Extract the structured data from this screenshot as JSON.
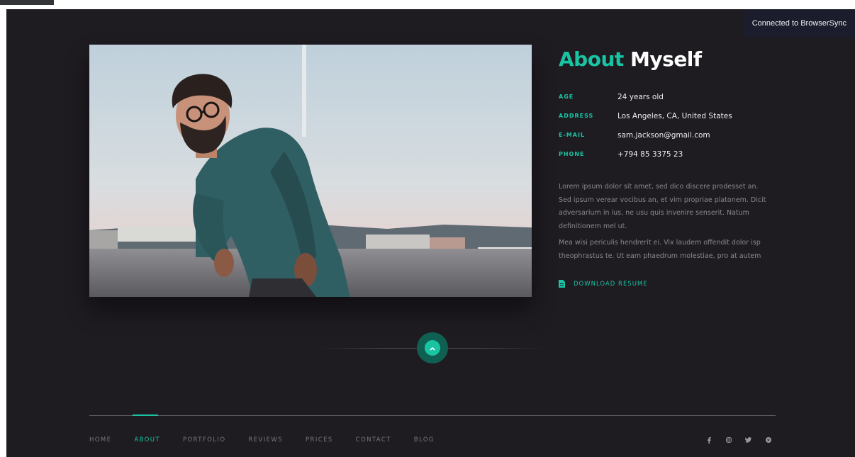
{
  "notification": {
    "text": "Connected to BrowserSync"
  },
  "about": {
    "title_accent": "About",
    "title_rest": "Myself",
    "info": [
      {
        "label": "AGE",
        "value": "24 years old"
      },
      {
        "label": "ADDRESS",
        "value": "Los Angeles, CA, United States"
      },
      {
        "label": "E-MAIL",
        "value": "sam.jackson@gmail.com"
      },
      {
        "label": "PHONE",
        "value": "+794 85 3375 23"
      }
    ],
    "bio": [
      "Lorem ipsum dolor sit amet, sed dico discere prodesset an. Sed ipsum verear vocibus an, et vim propriae platonem. Dicit adversarium in ius, ne usu quis invenire senserit. Natum definitionem mel ut.",
      "Mea wisi periculis hendrerit ei. Vix laudem offendit dolor isp theophrastus te. Ut eam phaedrum molestiae, pro at autem"
    ],
    "download_label": "DOWNLOAD RESUME",
    "download_icon": "document-icon"
  },
  "nav": {
    "items": [
      "HOME",
      "ABOUT",
      "PORTFOLIO",
      "REVIEWS",
      "PRICES",
      "CONTACT",
      "BLOG"
    ],
    "active": "ABOUT"
  },
  "social": [
    "facebook-icon",
    "instagram-icon",
    "twitter-icon",
    "pinterest-icon"
  ],
  "colors": {
    "accent": "#19c4a3",
    "background": "#1e1b21",
    "notification_bg": "#1b1d2d"
  }
}
